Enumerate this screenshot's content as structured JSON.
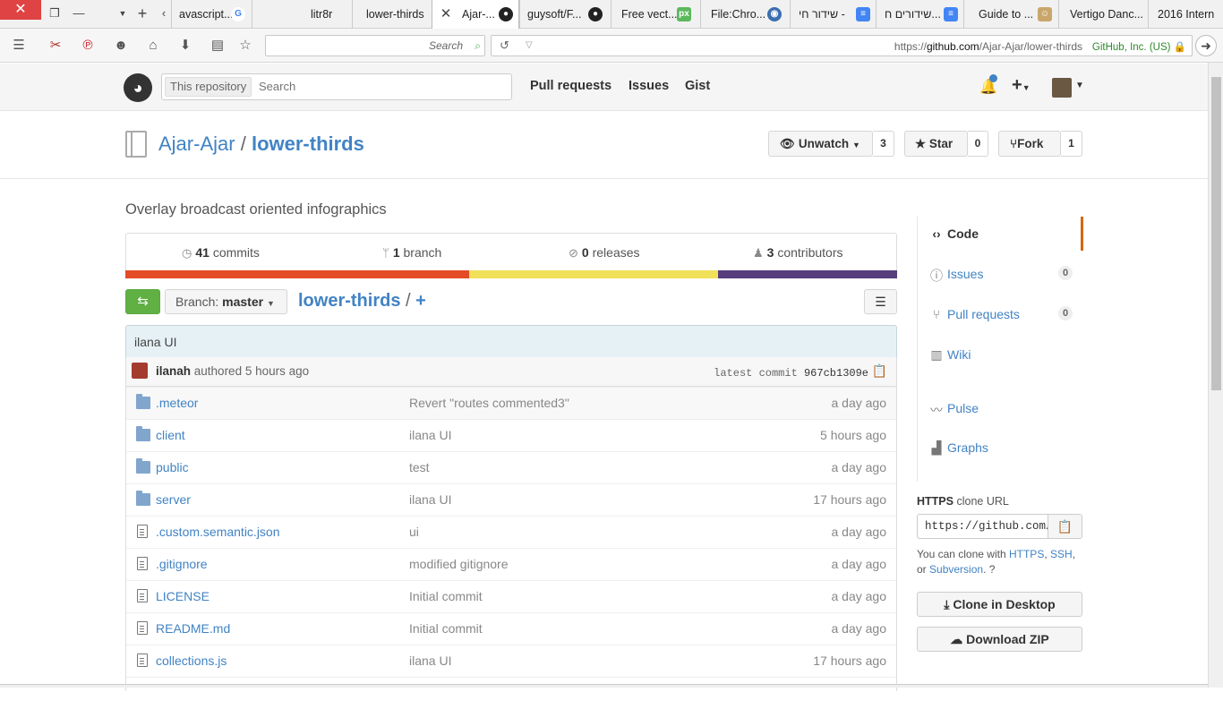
{
  "browser": {
    "tabs": [
      {
        "label": "avascript...",
        "icon": "google-icon"
      },
      {
        "label": "litr8r",
        "icon": ""
      },
      {
        "label": "lower-thirds",
        "icon": ""
      },
      {
        "label": "Ajar-...",
        "icon": "github-icon"
      },
      {
        "label": "guysoft/F...",
        "icon": "github-icon"
      },
      {
        "label": "Free vect...",
        "icon": "px-icon"
      },
      {
        "label": "File:Chro...",
        "icon": "wiki-icon"
      },
      {
        "label": "שידור חי -",
        "icon": "doc-icon"
      },
      {
        "label": "שידורים ח...",
        "icon": "doc-icon"
      },
      {
        "label": "Guide to ...",
        "icon": "guide-icon"
      },
      {
        "label": "Vertigo Danc...",
        "icon": ""
      },
      {
        "label": "2016 Intern",
        "icon": ""
      }
    ],
    "search_placeholder": "Search",
    "url_prefix": "https://",
    "url_host": "github.com",
    "url_path": "/Ajar-Ajar/lower-thirds",
    "identity": "GitHub, Inc. (US)"
  },
  "header": {
    "context_label": "This repository",
    "search_placeholder": "Search",
    "nav": [
      "Pull requests",
      "Issues",
      "Gist"
    ]
  },
  "repo": {
    "owner": "Ajar-Ajar",
    "separator": "/",
    "name": "lower-thirds",
    "watch_label": "Unwatch",
    "watch_count": "3",
    "star_label": "Star",
    "star_count": "0",
    "fork_label": "Fork",
    "fork_count": "1",
    "description": "Overlay broadcast oriented infographics"
  },
  "summary": {
    "commits_count": "41",
    "commits_label": "commits",
    "branch_count": "1",
    "branch_label": "branch",
    "releases_count": "0",
    "releases_label": "releases",
    "contributors_count": "3",
    "contributors_label": "contributors"
  },
  "language_colors": [
    "#e34c26",
    "#f1e05a",
    "#563d7c"
  ],
  "filenav": {
    "branch_prefix": "Branch:",
    "branch_name": "master",
    "crumb_repo": "lower-thirds",
    "crumb_sep": "/",
    "crumb_add": "+"
  },
  "commit": {
    "message": "ilana UI",
    "author": "ilanah",
    "authored": "authored 5 hours ago",
    "latest_label": "latest commit",
    "sha": "967cb1309e"
  },
  "files": [
    {
      "type": "folder",
      "name": ".meteor",
      "message": "Revert \"routes commented3\"",
      "age": "a day ago"
    },
    {
      "type": "folder",
      "name": "client",
      "message": "ilana UI",
      "age": "5 hours ago"
    },
    {
      "type": "folder",
      "name": "public",
      "message": "test",
      "age": "a day ago"
    },
    {
      "type": "folder",
      "name": "server",
      "message": "ilana UI",
      "age": "17 hours ago"
    },
    {
      "type": "file",
      "name": ".custom.semantic.json",
      "message": "ui",
      "age": "a day ago"
    },
    {
      "type": "file",
      "name": ".gitignore",
      "message": "modified gitignore",
      "age": "a day ago"
    },
    {
      "type": "file",
      "name": "LICENSE",
      "message": "Initial commit",
      "age": "a day ago"
    },
    {
      "type": "file",
      "name": "README.md",
      "message": "Initial commit",
      "age": "a day ago"
    },
    {
      "type": "file",
      "name": "collections.js",
      "message": "ilana UI",
      "age": "17 hours ago"
    }
  ],
  "sidebar": {
    "items": [
      {
        "label": "Code",
        "icon": "code-icon",
        "count": ""
      },
      {
        "label": "Issues",
        "icon": "issue-icon",
        "count": "0"
      },
      {
        "label": "Pull requests",
        "icon": "pull-request-icon",
        "count": "0"
      },
      {
        "label": "Wiki",
        "icon": "book-icon",
        "count": ""
      },
      {
        "label": "Pulse",
        "icon": "pulse-icon",
        "count": ""
      },
      {
        "label": "Graphs",
        "icon": "graph-icon",
        "count": ""
      }
    ],
    "clone_protocol": "HTTPS",
    "clone_label": "clone URL",
    "clone_url": "https://github.com/Ajar-Ajar/lower-thirds.git",
    "clone_help_prefix": "You can clone with",
    "clone_help_https": "HTTPS",
    "clone_help_ssh": "SSH",
    "clone_help_or": "or",
    "clone_help_svn": "Subversion",
    "clone_desktop_label": "Clone in Desktop",
    "download_zip_label": "Download ZIP"
  }
}
